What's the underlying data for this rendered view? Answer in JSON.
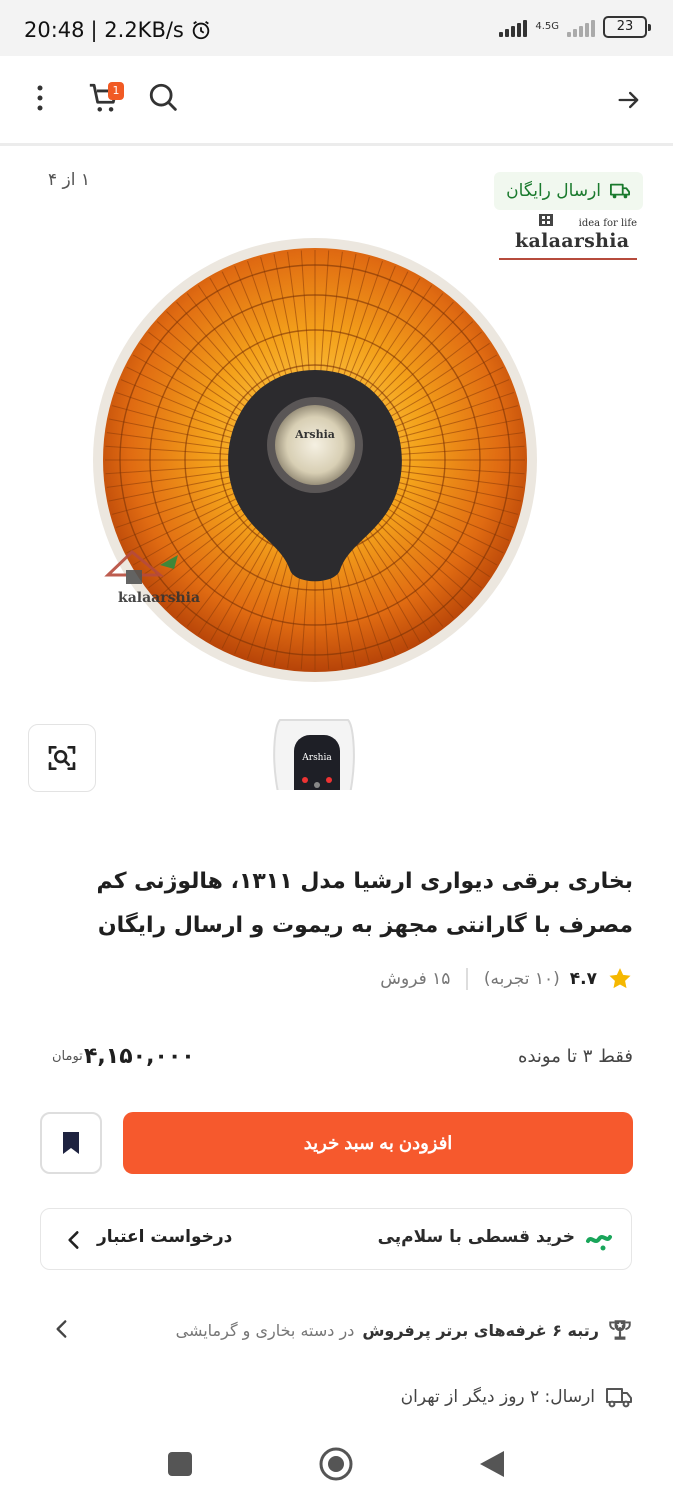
{
  "status_bar": {
    "time": "20:48",
    "net_speed": "| 2.2KB/s",
    "network_type": "4.5G",
    "battery": "23"
  },
  "app_bar": {
    "cart_count": "1",
    "icons": [
      "arrow-right-icon",
      "search-icon",
      "cart-icon",
      "more-vertical-icon"
    ]
  },
  "gallery": {
    "page_indicator": "۱ از ۴",
    "free_shipping": "ارسال رایگان",
    "brand_name": "kalaarshia",
    "brand_tagline": "idea for life",
    "watermark": "kalaarshia",
    "device_label": "Arshia"
  },
  "product": {
    "title": "بخاری برقی دیواری ارشیا مدل ۱۳۱۱، هالوژنی کم مصرف با گارانتی مجهز به ریموت و ارسال رایگان",
    "rating": "۴.۷",
    "reviews": "(۱۰ تجربه)",
    "sales": "۱۵ فروش",
    "stock": "فقط ۳ تا مونده",
    "price": "۴,۱۵۰,۰۰۰",
    "currency": "تومان"
  },
  "actions": {
    "add_to_cart": "افزودن به سبد خرید"
  },
  "installment": {
    "label": "خرید قسطی با سلام‌پی",
    "credit_request": "درخواست اعتبار"
  },
  "rank": {
    "bold": "رتبه ۶ غرفه‌های برتر پرفروش",
    "rest": "در دسته بخاری و گرمایشی"
  },
  "shipping": {
    "text": "ارسال: ۲ روز دیگر از تهران"
  },
  "colors": {
    "primary": "#f6592d",
    "green": "#1a7a2d",
    "star": "#f5b800"
  }
}
